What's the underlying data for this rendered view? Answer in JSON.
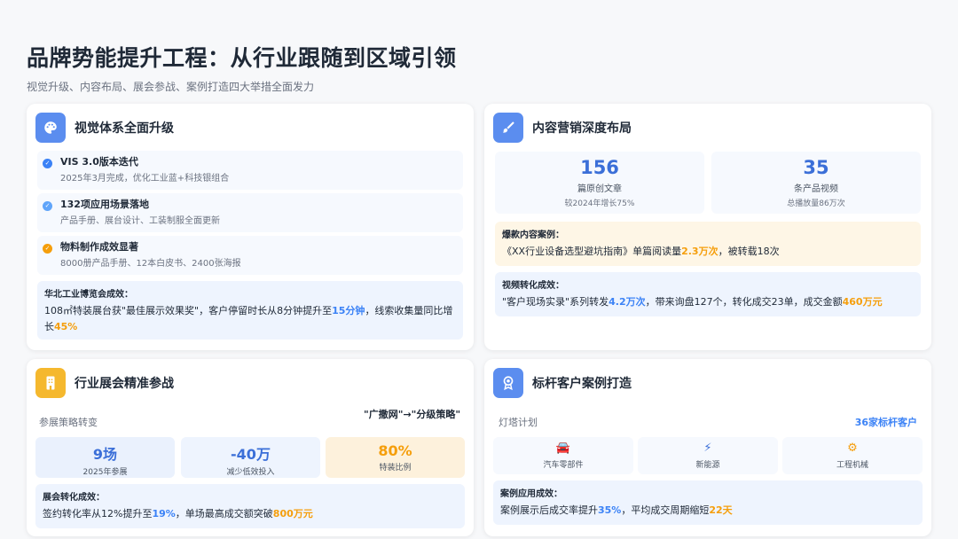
{
  "header": {
    "title": "品牌势能提升工程：从行业跟随到区域引领",
    "subtitle": "视觉升级、内容布局、展会参战、案例打造四大举措全面发力"
  },
  "visual": {
    "title": "视觉体系全面升级",
    "icon": "palette-icon",
    "items": [
      {
        "title": "VIS 3.0版本迭代",
        "desc": "2025年3月完成，优化工业蓝+科技银组合"
      },
      {
        "title": "132项应用场景落地",
        "desc": "产品手册、展台设计、工装制服全面更新"
      },
      {
        "title": "物料制作成效显著",
        "desc": "8000册产品手册、12本白皮书、2400张海报"
      }
    ],
    "highlight": {
      "label": "华北工业博览会成效：",
      "t1": "108㎡特装展台获\"最佳展示效果奖\"，客户停留时长从8分钟提升至",
      "v1": "15分钟",
      "t2": "，线索收集量同比增长",
      "v2": "45%"
    }
  },
  "content": {
    "title": "内容营销深度布局",
    "icon": "brush-icon",
    "stats": [
      {
        "value": "156",
        "label": "篇原创文章",
        "sub": "较2024年增长75%"
      },
      {
        "value": "35",
        "label": "条产品视频",
        "sub": "总播放量86万次"
      }
    ],
    "case1": {
      "label": "爆款内容案例：",
      "t1": "《XX行业设备选型避坑指南》单篇阅读量",
      "v1": "2.3万次",
      "t2": "，被转载18次"
    },
    "case2": {
      "label": "视频转化成效：",
      "t1": "\"客户现场实录\"系列转发",
      "v1": "4.2万次",
      "t2": "，带来询盘127个，转化成交23单，成交金额",
      "v2": "460万元"
    }
  },
  "expo": {
    "title": "行业展会精准参战",
    "icon": "building-icon",
    "strategy_label": "参展策略转变",
    "strategy_value": "\"广撒网\"→\"分级策略\"",
    "stats": [
      {
        "value": "9场",
        "label": "2025年参展"
      },
      {
        "value": "-40万",
        "label": "减少低效投入"
      },
      {
        "value": "80%",
        "label": "特装比例"
      }
    ],
    "result": {
      "label": "展会转化成效：",
      "t1": "签约转化率从12%提升至",
      "v1": "19%",
      "t2": "，单场最高成交额突破",
      "v2": "800万元"
    }
  },
  "benchmark": {
    "title": "标杆客户案例打造",
    "icon": "award-icon",
    "plan_label": "灯塔计划",
    "plan_value": "36家标杆客户",
    "industries": [
      {
        "icon": "car-icon",
        "glyph": "🚘",
        "label": "汽车零部件"
      },
      {
        "icon": "bolt-icon",
        "glyph": "⚡",
        "label": "新能源"
      },
      {
        "icon": "cog-icon",
        "glyph": "⚙",
        "label": "工程机械"
      }
    ],
    "result": {
      "label": "案例应用成效：",
      "t1": "案例展示后成交率提升",
      "v1": "35%",
      "t2": "，平均成交周期缩短",
      "v2": "22天"
    }
  },
  "colors": {
    "accent_blue": "#3b82f6",
    "accent_orange": "#f59e0b"
  }
}
